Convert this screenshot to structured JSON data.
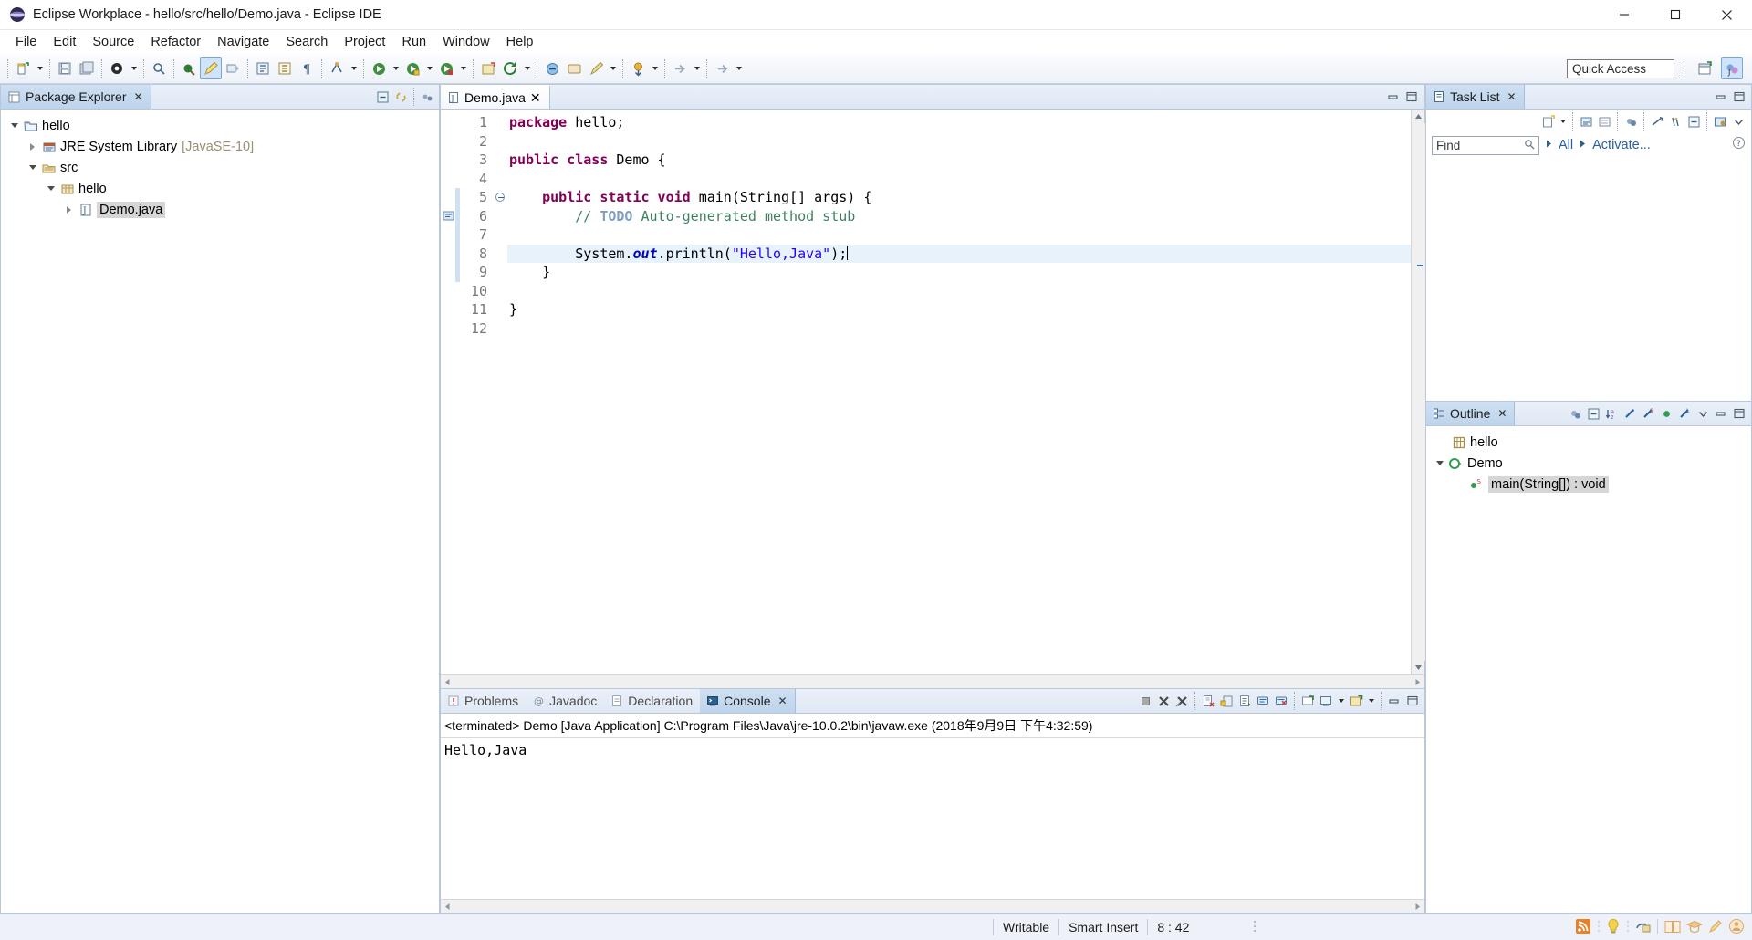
{
  "window": {
    "title": "Eclipse Workplace - hello/src/hello/Demo.java - Eclipse IDE",
    "app_icon": "eclipse-icon",
    "minimize_label": "Minimize",
    "maximize_label": "Maximize",
    "close_label": "Close"
  },
  "menubar": {
    "items": [
      {
        "label": "File"
      },
      {
        "label": "Edit"
      },
      {
        "label": "Source"
      },
      {
        "label": "Refactor"
      },
      {
        "label": "Navigate"
      },
      {
        "label": "Search"
      },
      {
        "label": "Project"
      },
      {
        "label": "Run"
      },
      {
        "label": "Window"
      },
      {
        "label": "Help"
      }
    ]
  },
  "toolbar": {
    "quick_access_placeholder": "Quick Access",
    "buttons": [
      {
        "name": "new-wizard",
        "icon": "new-file-icon"
      },
      {
        "name": "save",
        "icon": "save-icon"
      },
      {
        "name": "save-all",
        "icon": "save-all-icon"
      },
      {
        "name": "new-java-class",
        "icon": "java-class-icon"
      },
      {
        "name": "print",
        "icon": "print-icon"
      },
      {
        "name": "toggle-mark-occurrences",
        "icon": "pencil-icon"
      },
      {
        "name": "open-type",
        "icon": "open-type-icon"
      },
      {
        "name": "search",
        "icon": "search-icon"
      },
      {
        "name": "next-annotation",
        "icon": "next-annotation-icon"
      },
      {
        "name": "previous-annotation",
        "icon": "previous-annotation-icon"
      },
      {
        "name": "last-edit-location",
        "icon": "last-edit-icon"
      },
      {
        "name": "debug",
        "icon": "debug-icon"
      },
      {
        "name": "run",
        "icon": "run-icon"
      },
      {
        "name": "run-external-tools",
        "icon": "external-tools-icon"
      },
      {
        "name": "coverage",
        "icon": "coverage-icon"
      },
      {
        "name": "new-java-project",
        "icon": "new-project-icon"
      },
      {
        "name": "open-task",
        "icon": "task-icon"
      },
      {
        "name": "back",
        "icon": "back-icon"
      },
      {
        "name": "forward",
        "icon": "forward-icon"
      }
    ],
    "perspective_buttons": [
      {
        "name": "open-perspective",
        "icon": "open-perspective-icon"
      },
      {
        "name": "java-perspective",
        "icon": "java-perspective-icon"
      }
    ]
  },
  "package_explorer": {
    "title": "Package Explorer",
    "close_label": "✕",
    "toolbar": [
      {
        "name": "collapse-all",
        "icon": "collapse-all-icon"
      },
      {
        "name": "link-with-editor",
        "icon": "link-editor-icon"
      },
      {
        "name": "view-menu",
        "icon": "view-menu-icon"
      }
    ],
    "tree": [
      {
        "label": "hello",
        "icon": "java-project-icon",
        "indent": 0,
        "expanded": true,
        "selected": false,
        "suffix": ""
      },
      {
        "label": "JRE System Library",
        "icon": "library-icon",
        "indent": 1,
        "expanded": false,
        "selected": false,
        "suffix": "[JavaSE-10]"
      },
      {
        "label": "src",
        "icon": "source-folder-icon",
        "indent": 1,
        "expanded": true,
        "selected": false,
        "suffix": ""
      },
      {
        "label": "hello",
        "icon": "package-icon",
        "indent": 2,
        "expanded": true,
        "selected": false,
        "suffix": ""
      },
      {
        "label": "Demo.java",
        "icon": "java-file-icon",
        "indent": 3,
        "expanded": false,
        "selected": true,
        "suffix": ""
      }
    ]
  },
  "editor": {
    "tab_label": "Demo.java",
    "tab_icon": "java-file-icon",
    "tab_close": "✕",
    "minimize_label": "Minimize",
    "maximize_label": "Maximize",
    "line_numbers": [
      "1",
      "2",
      "3",
      "4",
      "5",
      "6",
      "7",
      "8",
      "9",
      "10",
      "11",
      "12"
    ],
    "lines": [
      {
        "n": 1,
        "highlight": false,
        "fold": false,
        "change": false,
        "tokens": [
          {
            "t": "package",
            "c": "kw"
          },
          {
            "t": " hello;",
            "c": ""
          }
        ]
      },
      {
        "n": 2,
        "highlight": false,
        "fold": false,
        "change": false,
        "tokens": []
      },
      {
        "n": 3,
        "highlight": false,
        "fold": false,
        "change": false,
        "tokens": [
          {
            "t": "public class",
            "c": "kw"
          },
          {
            "t": " Demo {",
            "c": ""
          }
        ]
      },
      {
        "n": 4,
        "highlight": false,
        "fold": false,
        "change": false,
        "tokens": []
      },
      {
        "n": 5,
        "highlight": false,
        "fold": true,
        "change": true,
        "tokens": [
          {
            "t": "    ",
            "c": ""
          },
          {
            "t": "public static void",
            "c": "kw"
          },
          {
            "t": " main(String[] args) {",
            "c": ""
          }
        ]
      },
      {
        "n": 6,
        "highlight": false,
        "fold": false,
        "change": true,
        "tokens": [
          {
            "t": "        // ",
            "c": "cmt"
          },
          {
            "t": "TODO",
            "c": "cmt-tag"
          },
          {
            "t": " Auto-generated method stub",
            "c": "cmt"
          }
        ]
      },
      {
        "n": 7,
        "highlight": false,
        "fold": false,
        "change": true,
        "tokens": []
      },
      {
        "n": 8,
        "highlight": true,
        "fold": false,
        "change": true,
        "tokens": [
          {
            "t": "        System.",
            "c": ""
          },
          {
            "t": "out",
            "c": "fld"
          },
          {
            "t": ".println(",
            "c": ""
          },
          {
            "t": "\"Hello,Java\"",
            "c": "str"
          },
          {
            "t": ");",
            "c": ""
          }
        ]
      },
      {
        "n": 9,
        "highlight": false,
        "fold": false,
        "change": true,
        "tokens": [
          {
            "t": "    }",
            "c": ""
          }
        ]
      },
      {
        "n": 10,
        "highlight": false,
        "fold": false,
        "change": false,
        "tokens": []
      },
      {
        "n": 11,
        "highlight": false,
        "fold": false,
        "change": false,
        "tokens": [
          {
            "t": "}",
            "c": ""
          }
        ]
      },
      {
        "n": 12,
        "highlight": false,
        "fold": false,
        "change": false,
        "tokens": []
      }
    ]
  },
  "bottom_panel": {
    "tabs": [
      {
        "label": "Problems",
        "icon": "problems-icon",
        "active": false
      },
      {
        "label": "Javadoc",
        "icon": "javadoc-icon",
        "active": false
      },
      {
        "label": "Declaration",
        "icon": "declaration-icon",
        "active": false
      },
      {
        "label": "Console",
        "icon": "console-icon",
        "active": true
      }
    ],
    "close_label": "✕",
    "console_header": "<terminated> Demo [Java Application] C:\\Program Files\\Java\\jre-10.0.2\\bin\\javaw.exe (2018年9月9日 下午4:32:59)",
    "console_output": "Hello,Java",
    "toolbar": [
      {
        "name": "terminate",
        "icon": "terminate-icon"
      },
      {
        "name": "remove-launch",
        "icon": "remove-icon"
      },
      {
        "name": "remove-all-terminated",
        "icon": "remove-all-icon"
      },
      {
        "name": "clear-console",
        "icon": "clear-console-icon"
      },
      {
        "name": "scroll-lock",
        "icon": "scroll-lock-icon"
      },
      {
        "name": "word-wrap",
        "icon": "word-wrap-icon"
      },
      {
        "name": "show-console-on-output",
        "icon": "show-console-output-icon"
      },
      {
        "name": "show-console-on-error",
        "icon": "show-console-error-icon"
      },
      {
        "name": "pin-console",
        "icon": "pin-console-icon"
      },
      {
        "name": "display-selected-console",
        "icon": "display-console-icon"
      },
      {
        "name": "open-console",
        "icon": "open-console-icon"
      },
      {
        "name": "minimize",
        "icon": "minimize-icon"
      },
      {
        "name": "maximize",
        "icon": "maximize-icon"
      }
    ]
  },
  "task_list": {
    "title": "Task List",
    "close_label": "✕",
    "find_placeholder": "Find",
    "find_value": "",
    "filter_all": "All",
    "filter_activate": "Activate...",
    "toolbar": [
      {
        "name": "new-task",
        "icon": "new-task-icon"
      },
      {
        "name": "categorized-presentation",
        "icon": "categorized-icon"
      },
      {
        "name": "scheduled-presentation",
        "icon": "scheduled-icon"
      },
      {
        "name": "focus-on-workweek",
        "icon": "focus-icon"
      },
      {
        "name": "synchronize-changed",
        "icon": "synchronize-icon"
      },
      {
        "name": "restore-tasks",
        "icon": "restore-icon"
      },
      {
        "name": "collapse-all",
        "icon": "collapse-all-icon"
      },
      {
        "name": "link-with-editor",
        "icon": "link-editor-icon"
      },
      {
        "name": "view-menu",
        "icon": "view-menu-icon"
      }
    ],
    "help_icon": "help-icon"
  },
  "outline": {
    "title": "Outline",
    "close_label": "✕",
    "toolbar": [
      {
        "name": "focus-on-active-task",
        "icon": "focus-task-icon"
      },
      {
        "name": "collapse-all",
        "icon": "collapse-all-icon"
      },
      {
        "name": "sort",
        "icon": "sort-icon"
      },
      {
        "name": "hide-fields",
        "icon": "hide-fields-icon"
      },
      {
        "name": "hide-static-fields",
        "icon": "hide-static-icon"
      },
      {
        "name": "hide-non-public",
        "icon": "hide-non-public-icon"
      },
      {
        "name": "hide-local-types",
        "icon": "hide-local-types-icon"
      },
      {
        "name": "view-menu",
        "icon": "view-menu-icon"
      },
      {
        "name": "minimize",
        "icon": "minimize-icon"
      },
      {
        "name": "maximize",
        "icon": "maximize-icon"
      }
    ],
    "tree": [
      {
        "label": "hello",
        "icon": "package-declaration-icon",
        "indent": 1,
        "expanded": null,
        "selected": false
      },
      {
        "label": "Demo",
        "icon": "class-icon",
        "indent": 0,
        "expanded": true,
        "selected": false
      },
      {
        "label": "main(String[]) : void",
        "icon": "public-static-method-icon",
        "indent": 2,
        "expanded": null,
        "selected": true
      }
    ]
  },
  "statusbar": {
    "writable": "Writable",
    "insert_mode": "Smart Insert",
    "position": "8 : 42",
    "icons": [
      {
        "name": "rss-icon"
      },
      {
        "name": "tip-of-the-day-icon"
      },
      {
        "name": "java-perspective-icon"
      },
      {
        "name": "book-icon"
      },
      {
        "name": "graduation-cap-icon"
      },
      {
        "name": "pencil-icon"
      },
      {
        "name": "user-icon"
      }
    ]
  },
  "colors": {
    "keyword": "#7f0055",
    "comment": "#3f7f5f",
    "string": "#2a00ff",
    "field": "#0000c0",
    "selection": "#d6d6d6",
    "line_highlight": "#e8f2fb"
  }
}
